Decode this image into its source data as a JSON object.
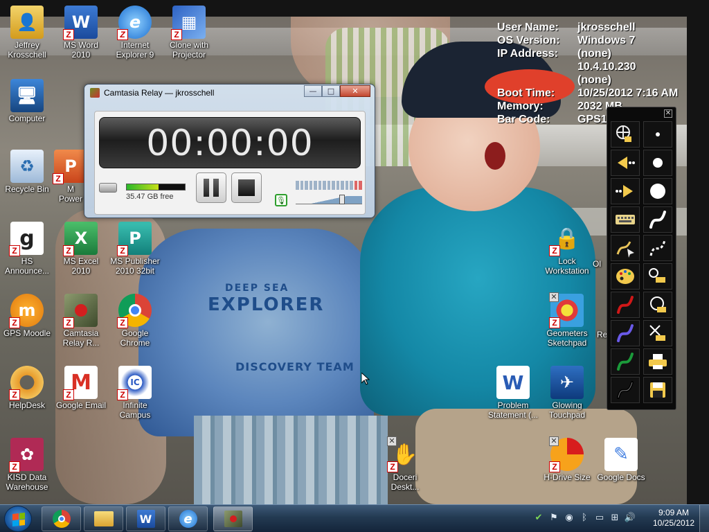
{
  "system_info": [
    {
      "key": "User Name:",
      "value": "jkrosschell"
    },
    {
      "key": "OS Version:",
      "value": "Windows 7"
    },
    {
      "key": "IP Address:",
      "value": "(none)"
    },
    {
      "key": "",
      "value": "10.4.10.230"
    },
    {
      "key": "",
      "value": "(none)"
    },
    {
      "key": "Boot Time:",
      "value": "10/25/2012 7:16 AM"
    },
    {
      "key": "Memory:",
      "value": "2032 MB"
    },
    {
      "key": "Bar Code:",
      "value": "GPS1"
    }
  ],
  "desktop_icons": [
    {
      "label": "Jeffrey\nKrosschell",
      "icon": "user-folder-icon"
    },
    {
      "label": "MS Word\n2010",
      "icon": "word-icon"
    },
    {
      "label": "Internet\nExplorer 9",
      "icon": "internet-explorer-icon"
    },
    {
      "label": "Clone with\nProjector",
      "icon": "display-clone-icon"
    },
    {
      "label": "Computer",
      "icon": "computer-icon"
    },
    {
      "label": "Recycle Bin",
      "icon": "recycle-bin-icon"
    },
    {
      "label": "M\nPower",
      "icon": "powerpoint-icon"
    },
    {
      "label": "HS\nAnnounce...",
      "icon": "announcements-icon"
    },
    {
      "label": "MS Excel 2010",
      "icon": "excel-icon"
    },
    {
      "label": "MS Publisher\n2010 32bit",
      "icon": "publisher-icon"
    },
    {
      "label": "GPS Moodle",
      "icon": "moodle-icon"
    },
    {
      "label": "Camtasia\nRelay R...",
      "icon": "camtasia-relay-icon"
    },
    {
      "label": "Google\nChrome",
      "icon": "chrome-icon"
    },
    {
      "label": "HelpDesk",
      "icon": "helpdesk-icon"
    },
    {
      "label": "Google Email",
      "icon": "gmail-icon"
    },
    {
      "label": "Infinite\nCampus",
      "icon": "infinite-campus-icon"
    },
    {
      "label": "KISD Data\nWarehouse",
      "icon": "data-warehouse-icon"
    },
    {
      "label": "Doceri\nDeskt...",
      "icon": "doceri-icon"
    },
    {
      "label": "Lock\nWorkstation",
      "icon": "lock-icon"
    },
    {
      "label": "Ol",
      "icon": "partial-icon"
    },
    {
      "label": "Geometers\nSketchpad",
      "icon": "sketchpad-icon"
    },
    {
      "label": "Re",
      "icon": "partial-icon"
    },
    {
      "label": "Problem\nStatement (...",
      "icon": "word-document-icon"
    },
    {
      "label": "Glowing\nTouchpad",
      "icon": "touchpad-icon"
    },
    {
      "label": "H-Drive Size",
      "icon": "pie-chart-icon"
    },
    {
      "label": "Google Docs",
      "icon": "google-docs-icon"
    }
  ],
  "camtasia": {
    "title": "Camtasia Relay — jkrosschell",
    "timer": "00:00:00",
    "disk_free": "35.47 GB free",
    "disk_used_fraction": 0.55,
    "volume_level": 0.72,
    "min_symbol": "—",
    "max_symbol": "□",
    "close_symbol": "✕"
  },
  "pen_palette": {
    "close_symbol": "✕",
    "left_tools": [
      "cursor-select-icon",
      "arrow-left-icon",
      "arrow-right-icon",
      "keyboard-icon",
      "pen-arrow-icon",
      "palette-icon",
      "pen-red-icon",
      "pen-blue-icon",
      "pen-green-icon",
      "pen-black-icon"
    ],
    "right_tools": [
      "dot-small-icon",
      "dot-medium-icon",
      "dot-large-icon",
      "stroke-thick-icon",
      "stroke-dashed-icon",
      "eraser-icon",
      "eraser-lasso-icon",
      "clear-all-icon",
      "print-icon",
      "save-icon"
    ]
  },
  "taskbar": {
    "pinned": [
      "chrome-icon",
      "explorer-folder-icon",
      "word-icon",
      "internet-explorer-icon",
      "camtasia-relay-icon"
    ],
    "time": "9:09 AM",
    "date": "10/25/2012"
  },
  "wallpaper": {
    "shirt_line1": "DEEP SEA",
    "shirt_line2": "EXPLORER",
    "shirt_line3": "DISCOVERY TEAM"
  },
  "colors": {
    "accent": "#1b5aa3",
    "badge_red": "#cc0000",
    "pen_red": "#d01818",
    "pen_blue": "#6a5ae8",
    "pen_green": "#1b9a3a"
  }
}
